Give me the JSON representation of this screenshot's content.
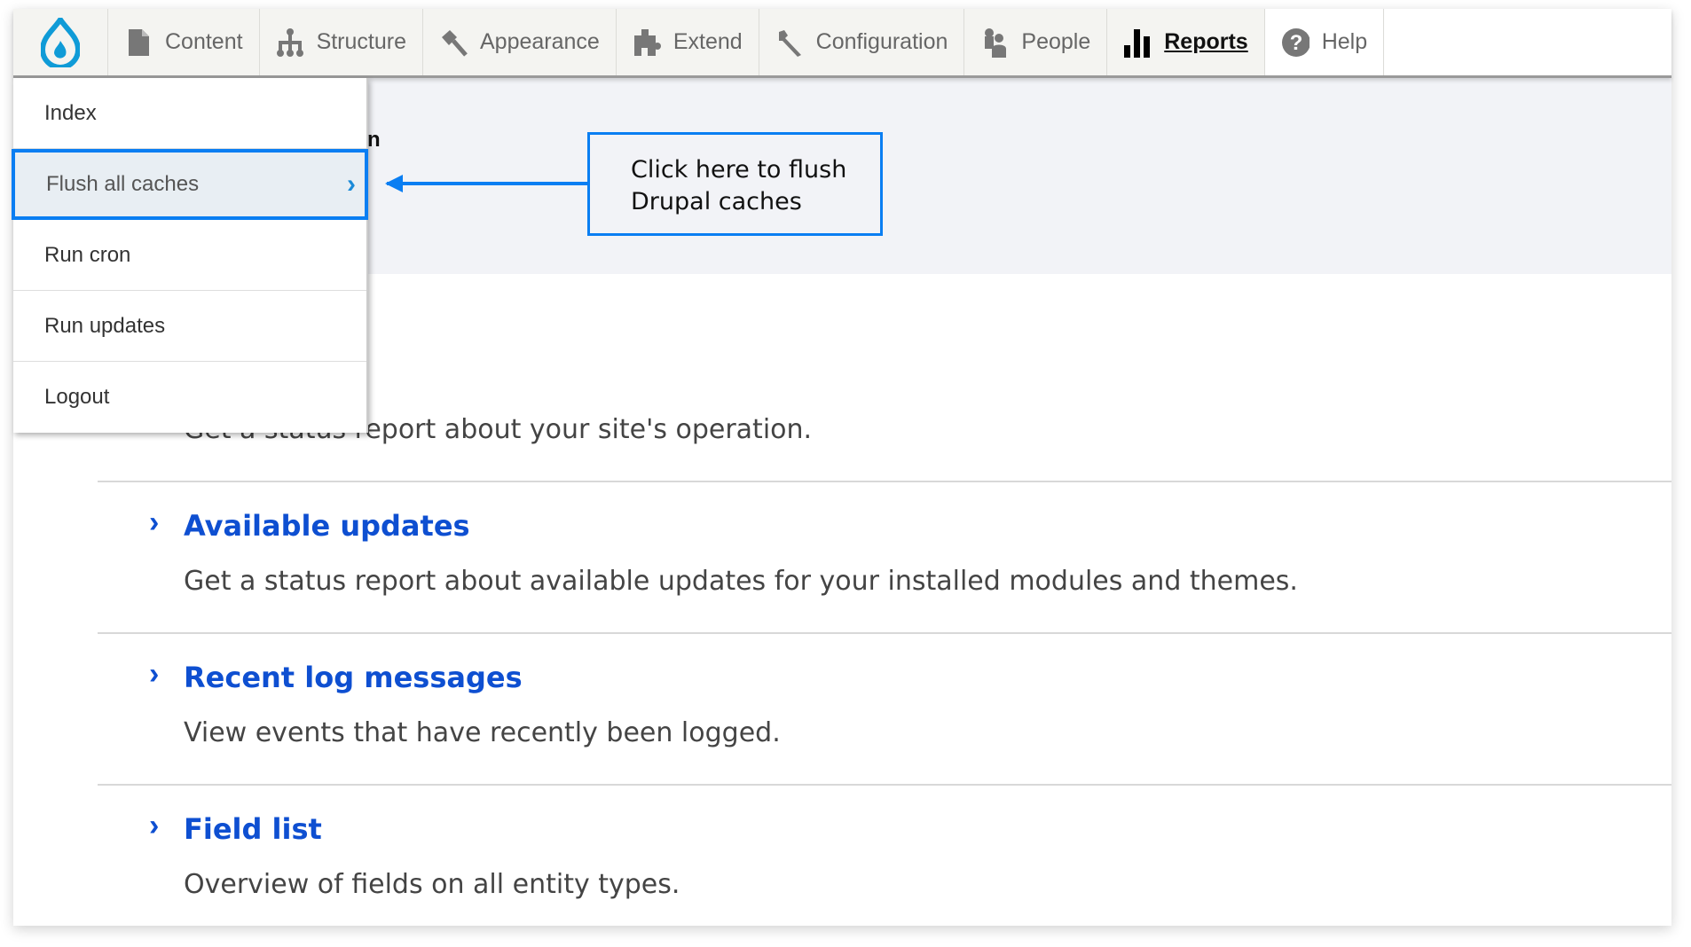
{
  "toolbar": {
    "logo": "drupal-logo",
    "tabs": [
      {
        "label": "Content",
        "icon": "file-icon"
      },
      {
        "label": "Structure",
        "icon": "sitemap-icon"
      },
      {
        "label": "Appearance",
        "icon": "paintbrush-icon"
      },
      {
        "label": "Extend",
        "icon": "puzzle-icon"
      },
      {
        "label": "Configuration",
        "icon": "wrench-icon"
      },
      {
        "label": "People",
        "icon": "people-icon"
      },
      {
        "label": "Reports",
        "icon": "bar-chart-icon",
        "active": true
      },
      {
        "label": "Help",
        "icon": "help-icon"
      }
    ]
  },
  "dropdown": {
    "items": [
      "Index",
      "Flush all caches",
      "Run cron",
      "Run updates",
      "Logout"
    ],
    "selected": "Flush all caches"
  },
  "callout": {
    "line1": "Click here to flush",
    "line2": "Drupal caches"
  },
  "heading_fragment": "n",
  "reports": [
    {
      "desc": "Get a status report about your site's operation."
    },
    {
      "title": "Available updates",
      "desc": "Get a status report about available updates for your installed modules and themes."
    },
    {
      "title": "Recent log messages",
      "desc": "View events that have recently been logged."
    },
    {
      "title": "Field list",
      "desc": "Overview of fields on all entity types."
    }
  ],
  "colors": {
    "accent": "#0a7ef2",
    "link": "#0e4fd1",
    "drupal": "#0f9bd7"
  }
}
